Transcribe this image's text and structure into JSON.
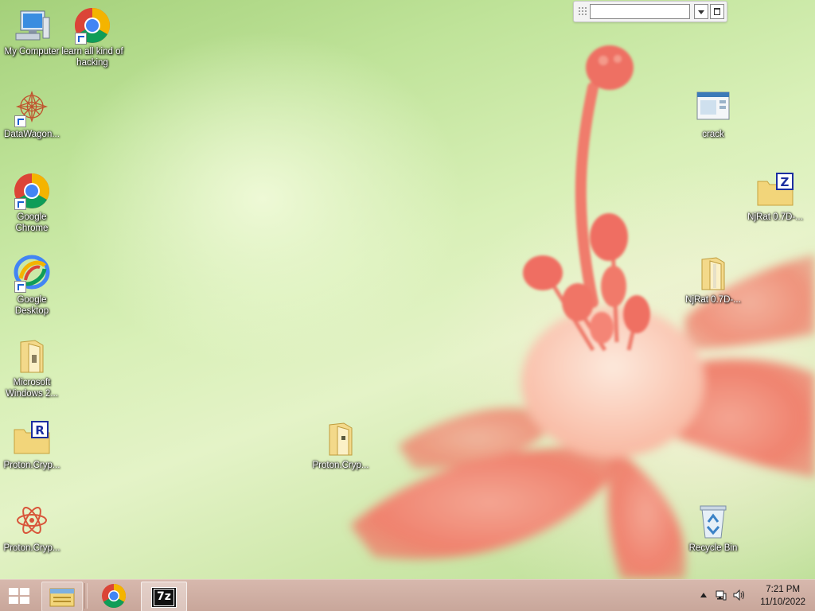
{
  "desktop": {
    "icons": [
      {
        "id": "my-computer",
        "label": "My Computer"
      },
      {
        "id": "chrome-hacking",
        "label": "learn all kind of hacking"
      },
      {
        "id": "datawagon",
        "label": "DataWagon..."
      },
      {
        "id": "google-chrome",
        "label": "Google Chrome"
      },
      {
        "id": "google-desktop",
        "label": "Google Desktop"
      },
      {
        "id": "ms-windows",
        "label": "Microsoft Windows 2..."
      },
      {
        "id": "proton-rar",
        "label": "Proton.Cryp..."
      },
      {
        "id": "proton-atom",
        "label": "Proton.Cryp..."
      },
      {
        "id": "proton-folder",
        "label": "Proton.Cryp..."
      },
      {
        "id": "crack",
        "label": "crack"
      },
      {
        "id": "njrat-zip",
        "label": "NjRat 0.7D-..."
      },
      {
        "id": "njrat-folder",
        "label": "NjRat 0.7D-..."
      },
      {
        "id": "recycle-bin",
        "label": "Recycle Bin"
      }
    ]
  },
  "toolbar": {
    "address_value": ""
  },
  "taskbar": {
    "start_icon": "windows-logo-icon",
    "pinned": [
      "file-explorer-icon",
      "chrome-icon",
      "7zip-icon"
    ],
    "sevenzip_label": "7z",
    "clock": {
      "time": "7:21 PM",
      "date": "11/10/2022"
    }
  },
  "colors": {
    "taskbar": "#cba99d",
    "label_text": "#ffffff",
    "chrome_red": "#db4437",
    "chrome_yellow": "#f4b400",
    "chrome_green": "#0f9d58",
    "chrome_blue": "#4285f4"
  }
}
